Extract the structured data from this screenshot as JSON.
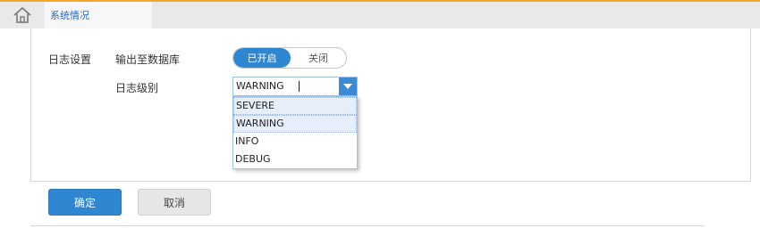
{
  "tabs": {
    "active_label": "系统情况"
  },
  "settings": {
    "section_label": "日志设置",
    "db_output_label": "输出至数据库",
    "toggle_on_label": "已开启",
    "toggle_off_label": "关闭",
    "log_level_label": "日志级别",
    "log_level_value": "WARNING",
    "log_level_options": [
      "SEVERE",
      "WARNING",
      "INFO",
      "DEBUG"
    ]
  },
  "actions": {
    "confirm_label": "确定",
    "cancel_label": "取消"
  },
  "colors": {
    "accent": "#f5a623",
    "primary": "#2f86d1",
    "tab_text": "#2a67b7"
  }
}
